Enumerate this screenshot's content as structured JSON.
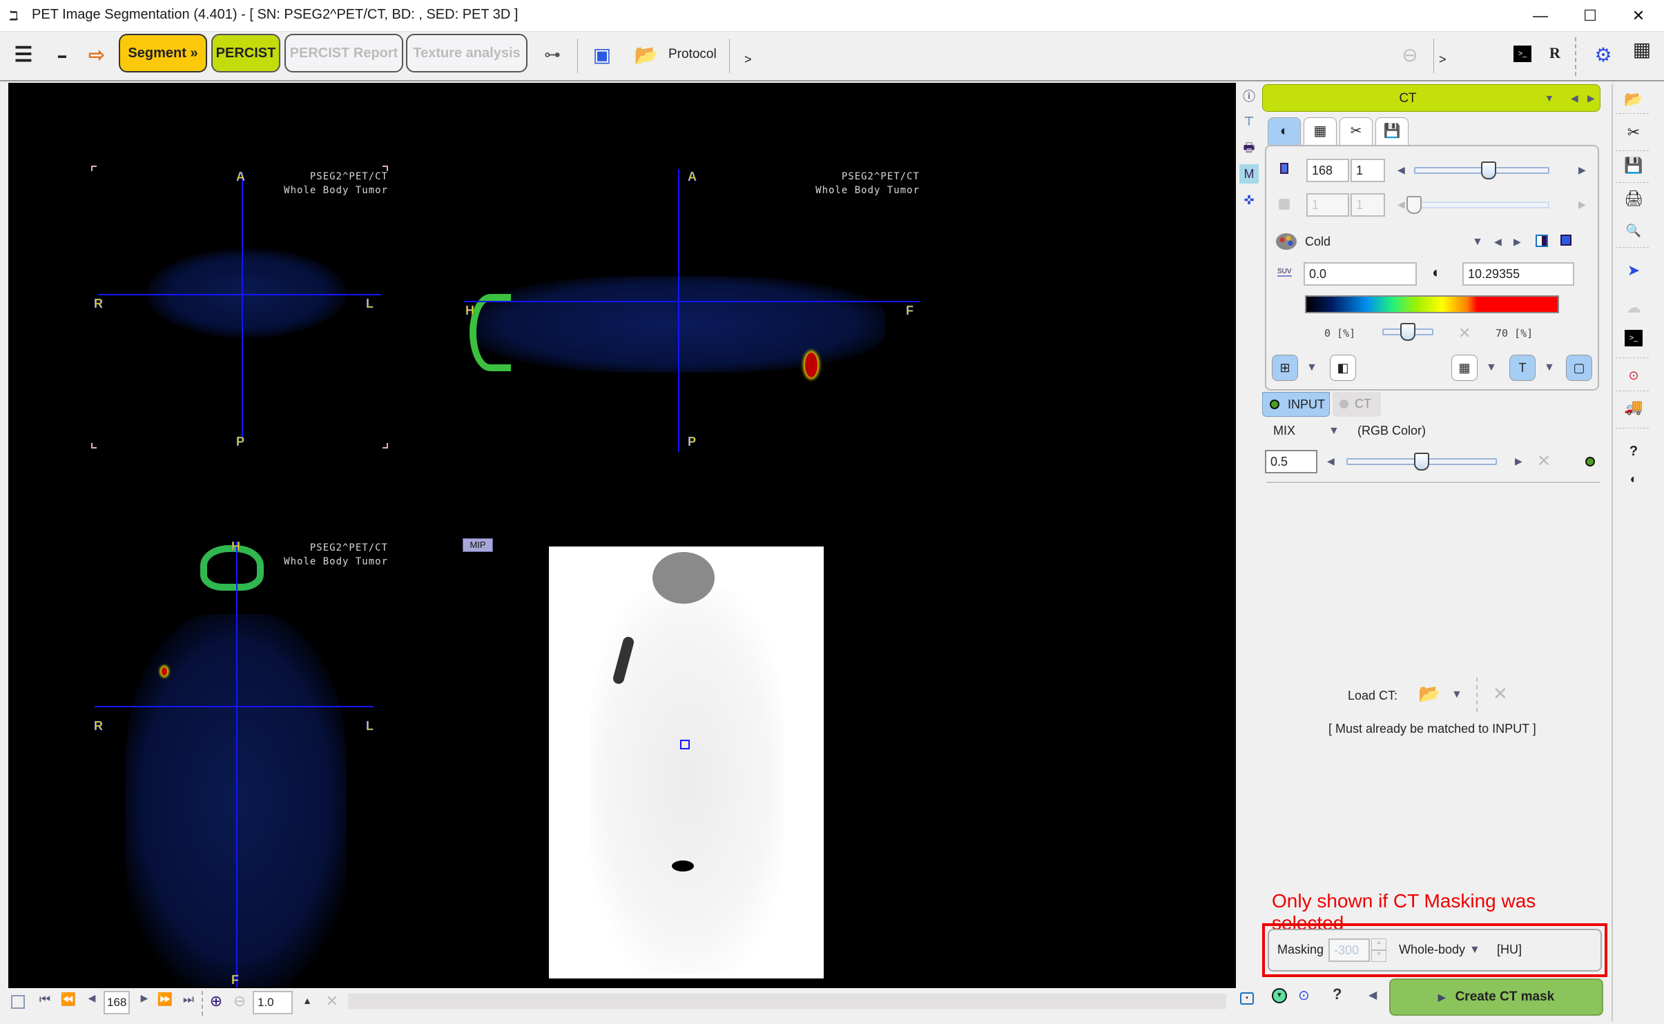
{
  "window": {
    "title": "PET Image Segmentation (4.401) - [ SN: PSEG2^PET/CT, BD: , SED: PET 3D ]",
    "app_icon": "ℶ",
    "minimize": "—",
    "maximize": "☐",
    "close": "✕"
  },
  "toolbar": {
    "menu_icon": "☰",
    "minimize_icon": "▬",
    "load_icon": "⇨",
    "buttons": [
      {
        "label": "Segment »",
        "state": "active"
      },
      {
        "label": "PERCIST",
        "state": "enabled"
      },
      {
        "label": "PERCIST Report",
        "state": "disabled"
      },
      {
        "label": "Texture analysis",
        "state": "disabled"
      }
    ],
    "link_icon": "⊶",
    "save_protocol_icon": "▣",
    "protocol_label": "Protocol",
    "more_left": ">",
    "more_right": ">",
    "stop_icon": "⊖",
    "console_icon": ">_",
    "r_label": "R",
    "plugins_icon": "⚙",
    "layout_icon": "▦"
  },
  "viewer": {
    "patient_line1": "PSEG2^PET/CT",
    "patient_line2": "Whole Body Tumor",
    "axial": {
      "top": "A",
      "bottom": "P",
      "left": "R",
      "right": "L"
    },
    "sagittal": {
      "top": "A",
      "bottom": "P",
      "left": "H",
      "right": "F"
    },
    "coronal": {
      "top": "H",
      "bottom": "F",
      "left": "R",
      "right": "L"
    },
    "mip_label": "MIP"
  },
  "navbar": {
    "slice": "168",
    "zoom": "1.0",
    "first": "⏮",
    "fast_back": "⏪",
    "back": "◀",
    "forward": "▶",
    "fast_forward": "⏩",
    "last": "⏭",
    "zoom_in": "⊕",
    "zoom_out": "⊖",
    "up": "▲",
    "reset": "✕"
  },
  "left_tools": [
    "ⓘ",
    "⊤",
    "🖶",
    "M",
    "✜"
  ],
  "panel": {
    "series_label": "CT",
    "tabs": [
      "◐",
      "▦",
      "✂",
      "💾"
    ],
    "slice_value": "168",
    "slice_step": "1",
    "slice_fraction": 0.55,
    "frame_value": "1",
    "frame_step": "1",
    "frame_fraction": 0.0,
    "colormap": "Cold",
    "min_value": "0.0",
    "max_value": "10.29355",
    "unit_icon": "SUV",
    "lower_pct": "0",
    "upper_pct": "70",
    "pct_unit": "[%]",
    "gamma_fraction": 0.5,
    "tabs2": [
      {
        "label": "INPUT",
        "state": "active",
        "dot": "#4aa020"
      },
      {
        "label": "CT",
        "state": "inactive",
        "dot": "#bdbdbd"
      }
    ],
    "fusion_mode": "MIX",
    "fusion_color": "(RGB Color)",
    "mix_value": "0.5",
    "mix_fraction": 0.5,
    "load_ct_label": "Load CT:",
    "load_ct_note": "[ Must already be matched to INPUT ]",
    "annotation": "Only shown if CT Masking was selected",
    "masking_label": "Masking",
    "masking_value": "-300",
    "masking_region": "Whole-body",
    "masking_unit": "[HU]",
    "create_button": "Create CT mask",
    "help_label": "?"
  },
  "right_tools": [
    "📂",
    "✂",
    "💾",
    "🖨",
    "🔍",
    "➤",
    "☁",
    ">_",
    "⊙",
    "🚚",
    "?",
    "◐"
  ],
  "colors": {
    "accent_segment": "#fcc80a",
    "accent_percist": "#c4dc0c",
    "ct_bar": "#c4e00a",
    "create_button": "#8bc45b",
    "annotation": "#ee0000",
    "crosshair": "#1515ff"
  }
}
